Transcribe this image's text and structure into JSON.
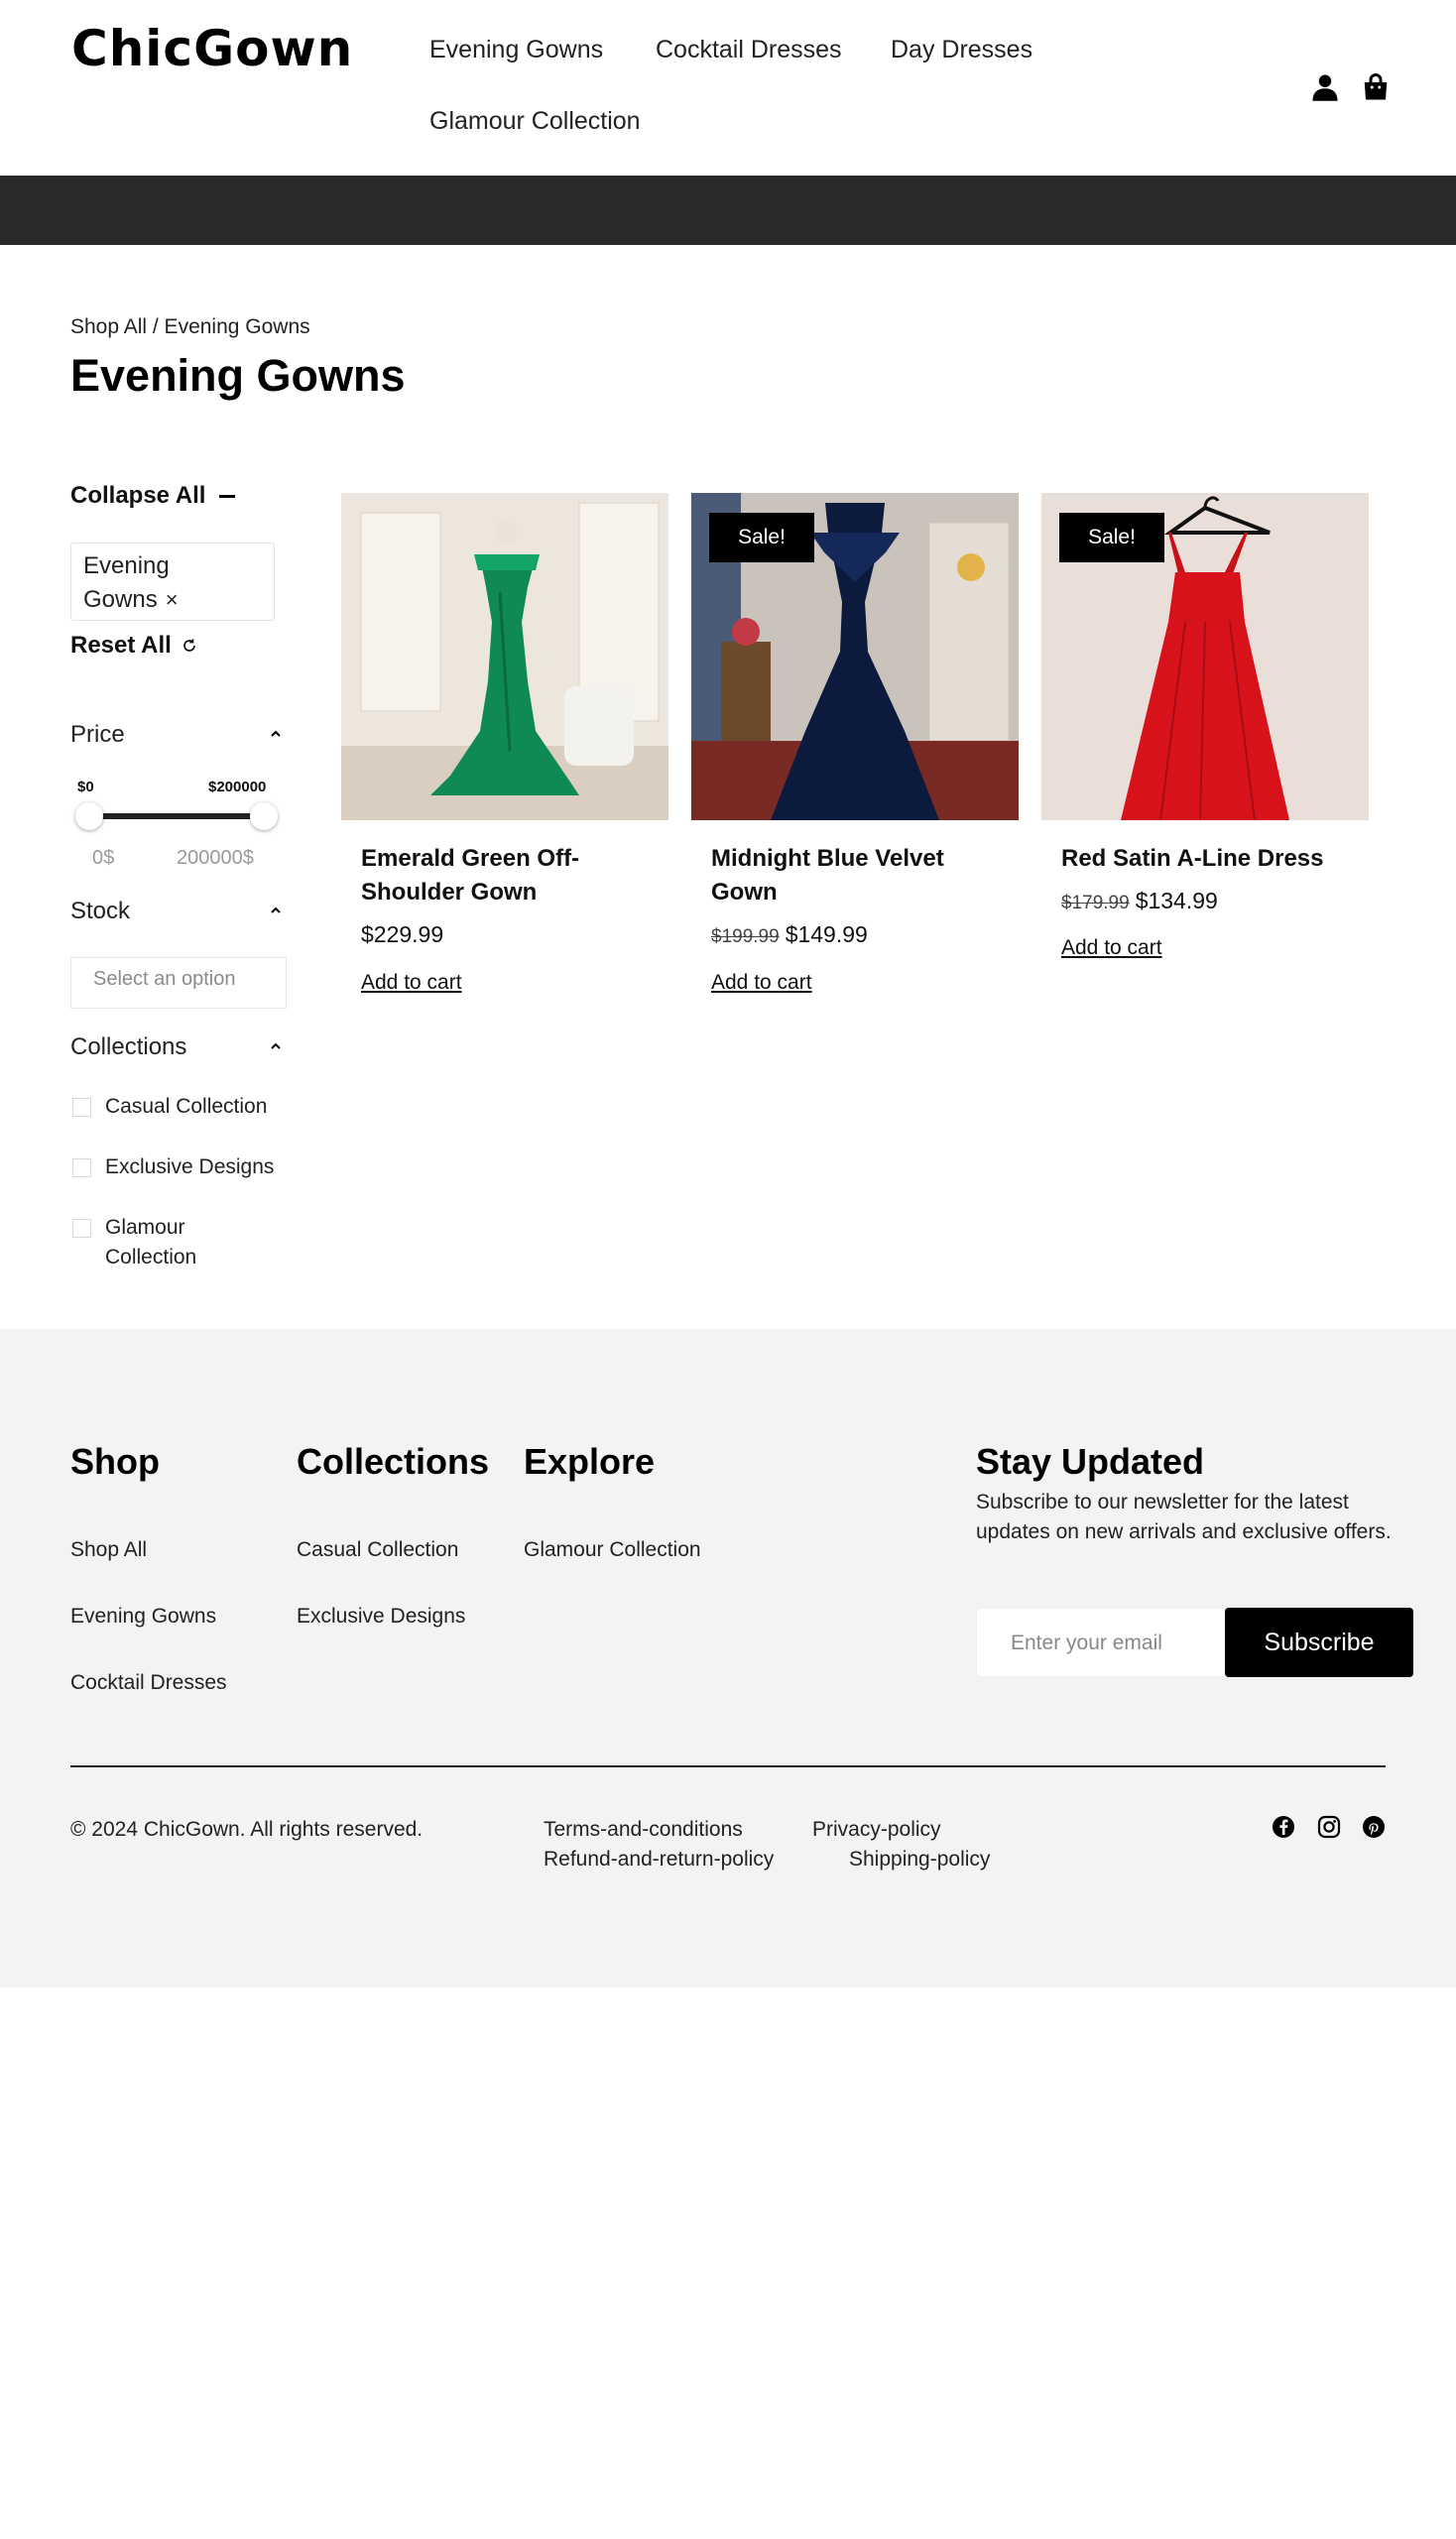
{
  "header": {
    "logo": "ChicGown",
    "nav": [
      "Evening Gowns",
      "Cocktail Dresses",
      "Day Dresses",
      "Glamour Collection"
    ],
    "icons": [
      "user-icon",
      "shopping-bag-icon"
    ]
  },
  "page": {
    "breadcrumb": "Shop All / Evening Gowns",
    "title": "Evening Gowns"
  },
  "sidebar": {
    "collapse_all": "Collapse All",
    "active_filter": "Evening Gowns",
    "active_filter_remove": "×",
    "reset_all": "Reset All",
    "price": {
      "label": "Price",
      "min_label": "$0",
      "max_label": "$200000",
      "min_input": "0$",
      "max_input": "200000$",
      "range": [
        0,
        1
      ]
    },
    "stock": {
      "label": "Stock",
      "placeholder": "Select an option"
    },
    "collections": {
      "label": "Collections",
      "options": [
        {
          "label": "Casual Collection",
          "checked": false
        },
        {
          "label": "Exclusive Designs",
          "checked": false
        },
        {
          "label": "Glamour Collection",
          "checked": false
        }
      ]
    }
  },
  "products": [
    {
      "name": "Emerald Green Off-Shoulder Gown",
      "price": "$229.99",
      "old_price": "",
      "sale_badge": "",
      "cart": "Add to cart",
      "color": "#0f8a55"
    },
    {
      "name": "Midnight Blue Velvet Gown",
      "price": "$149.99",
      "old_price": "$199.99",
      "sale_badge": "Sale!",
      "cart": "Add to cart",
      "color": "#0c1a3d"
    },
    {
      "name": "Red Satin A-Line Dress",
      "price": "$134.99",
      "old_price": "$179.99",
      "sale_badge": "Sale!",
      "cart": "Add to cart",
      "color": "#d8121b"
    }
  ],
  "footer": {
    "shop": {
      "title": "Shop",
      "links": [
        "Shop All",
        "Evening Gowns",
        "Cocktail Dresses"
      ]
    },
    "collections": {
      "title": "Collections",
      "links": [
        "Casual Collection",
        "Exclusive Designs"
      ]
    },
    "explore": {
      "title": "Explore",
      "links": [
        "Glamour Collection"
      ]
    },
    "newsletter": {
      "title": "Stay Updated",
      "description": "Subscribe to our newsletter for the latest updates on new arrivals and exclusive offers.",
      "placeholder": "Enter your email",
      "button": "Subscribe"
    },
    "copyright": "© 2024 ChicGown. All rights reserved.",
    "policies": [
      "Terms-and-conditions",
      "Privacy-policy",
      "Refund-and-return-policy",
      "Shipping-policy"
    ],
    "social": [
      "facebook-icon",
      "instagram-icon",
      "pinterest-icon"
    ]
  }
}
